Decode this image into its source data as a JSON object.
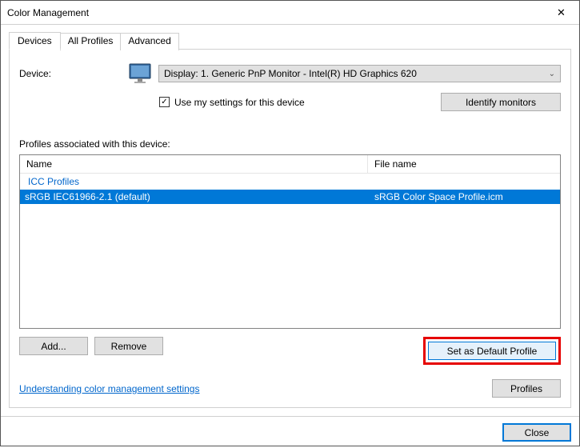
{
  "window": {
    "title": "Color Management"
  },
  "tabs": {
    "devices": "Devices",
    "all_profiles": "All Profiles",
    "advanced": "Advanced"
  },
  "device": {
    "label": "Device:",
    "selected": "Display: 1. Generic PnP Monitor - Intel(R) HD Graphics 620",
    "use_settings_label": "Use my settings for this device",
    "identify_label": "Identify monitors"
  },
  "profiles": {
    "section_label": "Profiles associated with this device:",
    "col_name": "Name",
    "col_file": "File name",
    "group": "ICC Profiles",
    "row_name": "sRGB IEC61966-2.1 (default)",
    "row_file": "sRGB Color Space Profile.icm"
  },
  "buttons": {
    "add": "Add...",
    "remove": "Remove",
    "set_default": "Set as Default Profile",
    "profiles": "Profiles",
    "close": "Close"
  },
  "link": {
    "understanding": "Understanding color management settings"
  }
}
